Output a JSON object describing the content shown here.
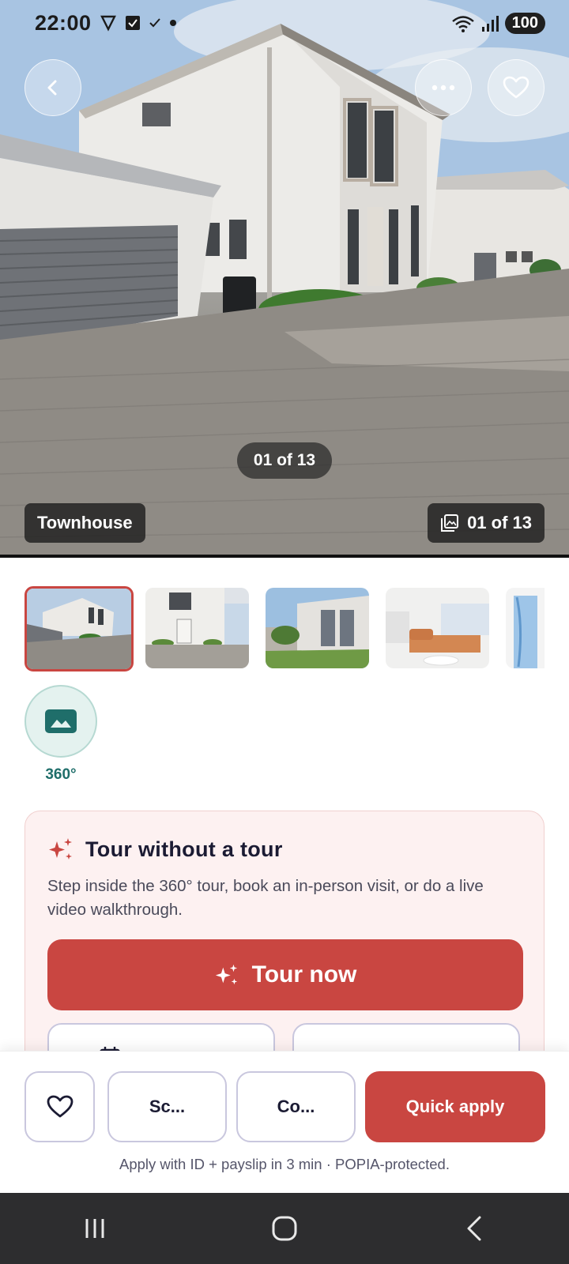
{
  "status_bar": {
    "time": "22:00",
    "battery": "100",
    "icons_left": [
      "vpn-shield-icon",
      "checkbox-icon",
      "check-icon",
      "dot-icon"
    ],
    "icons_right": [
      "wifi-icon",
      "signal-icon"
    ]
  },
  "hero": {
    "image_counter": "01 of 13",
    "property_type": "Townhouse",
    "gallery_counter": "01 of 13",
    "icons": [
      "back-chevron-icon",
      "more-icon",
      "heart-icon",
      "gallery-icon"
    ]
  },
  "thumbnails": [
    {
      "active": true,
      "subject": "townhouse-exterior"
    },
    {
      "active": false,
      "subject": "front-door"
    },
    {
      "active": false,
      "subject": "patio"
    },
    {
      "active": false,
      "subject": "living-room"
    },
    {
      "active": false,
      "subject": "curtains"
    }
  ],
  "pano": {
    "label": "360°",
    "icon": "image-icon"
  },
  "tour_card": {
    "title": "Tour without a tour",
    "description": "Step inside the 360° tour, book an in-person visit, or do a live video walkthrough.",
    "tour_now_label": "Tour now",
    "icon": "sparkle-icon"
  },
  "action_bar": {
    "schedule_label": "Sc...",
    "contact_label": "Co...",
    "apply_label": "Quick apply",
    "note": "Apply with ID + payslip in 3 min · POPIA-protected."
  },
  "colors": {
    "accent": "#c94641",
    "teal": "#1f6e6a",
    "card_bg": "#fdf1f1"
  }
}
